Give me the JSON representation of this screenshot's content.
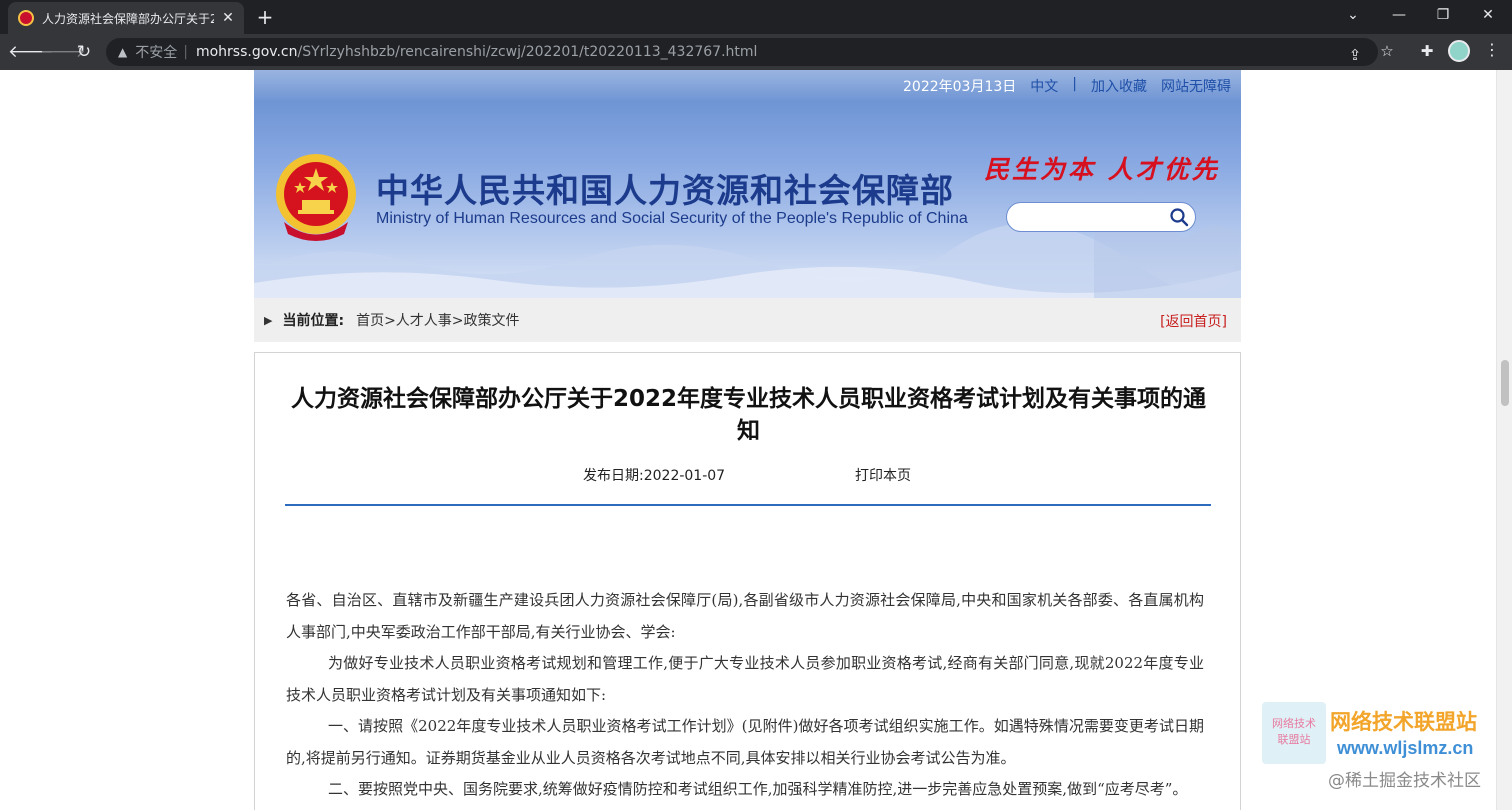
{
  "browser": {
    "tab_title": "人力资源社会保障部办公厅关于2",
    "tab_close": "✕",
    "new_tab": "+",
    "window_controls": [
      "⌄",
      "—",
      "❐",
      "✕"
    ],
    "insecure_label": "不安全",
    "url_host": "mohrss.gov.cn",
    "url_path": "/SYrlzyhshbzb/rencairenshi/zcwj/202201/t20220113_432767.html",
    "icons": [
      "back-icon",
      "forward-icon",
      "reload-icon",
      "warning-icon",
      "share-icon",
      "star-icon",
      "extensions-icon",
      "profile-avatar",
      "menu-icon"
    ]
  },
  "header": {
    "date": "2022年03月13日",
    "lang": "中文",
    "divider": "|",
    "bookmark": "加入收藏",
    "accessibility": "网站无障碍",
    "title_cn": "中华人民共和国人力资源和社会保障部",
    "title_en": "Ministry of Human Resources and Social Security of the People's Republic of China",
    "slogan": "民生为本 人才优先",
    "search_placeholder": ""
  },
  "breadcrumb": {
    "label": "当前位置:",
    "path": "首页>人才人事>政策文件",
    "back_home": "[返回首页]"
  },
  "article": {
    "title": "人力资源社会保障部办公厅关于2022年度专业技术人员职业资格考试计划及有关事项的通知",
    "publish_date": "发布日期:2022-01-07",
    "print": "打印本页",
    "paragraphs": [
      "各省、自治区、直辖市及新疆生产建设兵团人力资源社会保障厅(局),各副省级市人力资源社会保障局,中央和国家机关各部委、各直属机构人事部门,中央军委政治工作部干部局,有关行业协会、学会:",
      "为做好专业技术人员职业资格考试规划和管理工作,便于广大专业技术人员参加职业资格考试,经商有关部门同意,现就2022年度专业技术人员职业资格考试计划及有关事项通知如下:",
      "一、请按照《2022年度专业技术人员职业资格考试工作计划》(见附件)做好各项考试组织实施工作。如遇特殊情况需要变更考试日期的,将提前另行通知。证券期货基金业从业人员资格各次考试地点不同,具体安排以相关行业协会考试公告为准。",
      "二、要按照党中央、国务院要求,统筹做好疫情防控和考试组织工作,加强科学精准防控,进一步完善应急处置预案,做到“应考尽考”。"
    ]
  },
  "watermark": {
    "box_line1": "网络技术",
    "box_line2": "联盟站",
    "name": "网络技术联盟站",
    "url": "www.wljslmz.cn",
    "community": "@稀土掘金技术社区"
  },
  "colors": {
    "accent_blue": "#2c6bbd",
    "title_blue": "#1c3b8c",
    "slogan_red": "#d6101e",
    "link_red": "#c81e1e"
  }
}
